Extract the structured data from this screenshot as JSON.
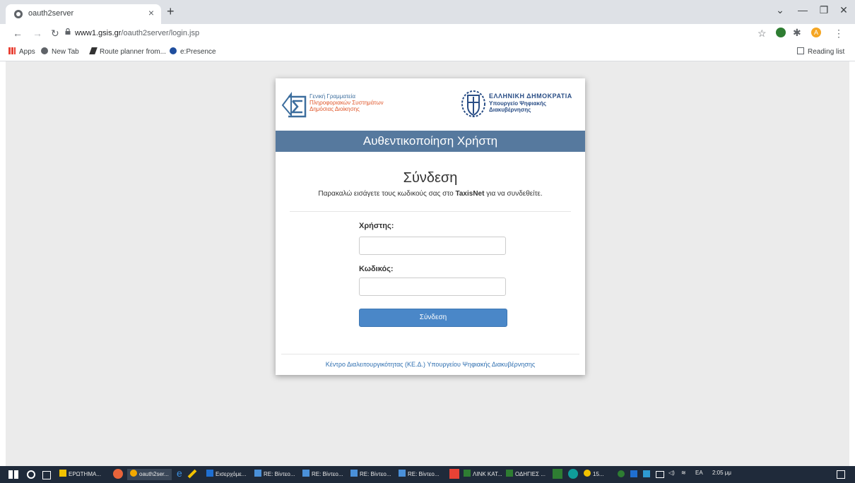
{
  "browser": {
    "tab_title": "oauth2server",
    "tab_close": "×",
    "new_tab": "+",
    "window_controls": [
      "⌄",
      "—",
      "❐",
      "✕"
    ],
    "url_host": "www1.gsis.gr",
    "url_path": "/oauth2server/login.jsp",
    "profile_initial": "A",
    "colors": {
      "tabbar": "#dee1e6",
      "profile": "#f5a623"
    }
  },
  "bookmarks": {
    "apps": "Apps",
    "items": [
      "New Tab",
      "Route planner from...",
      "e:Presence"
    ],
    "reading_list": "Reading list"
  },
  "header": {
    "gsis_lines": [
      "Γενική Γραμματεία",
      "Πληροφοριακών Συστημάτων",
      "Δημόσιας Διοίκησης"
    ],
    "gov_title": "ΕΛΛΗΝΙΚΗ ΔΗΜΟΚΡΑΤΙΑ",
    "gov_sub_lines": [
      "Υπουργείο Ψηφιακής",
      "Διακυβέρνησης"
    ]
  },
  "login": {
    "banner": "Αυθεντικοποίηση Χρήστη",
    "title": "Σύνδεση",
    "intro_before": "Παρακαλώ εισάγετε τους κωδικούς σας στο ",
    "intro_bold": "TaxisNet",
    "intro_after": " για να συνδεθείτε.",
    "username_label": "Χρήστης:",
    "username_value": "",
    "password_label": "Κωδικός:",
    "password_value": "",
    "submit_label": "Σύνδεση",
    "footer_link": "Κέντρο Διαλειτουργικότητας (ΚΕ.Δ.) Υπουργείου Ψηφιακής Διακυβέρνησης",
    "colors": {
      "banner": "#56799e",
      "button": "#4a87c8",
      "link": "#2f6fb0"
    }
  },
  "taskbar": {
    "items": [
      {
        "label": "ΕΡΩΤΗΜΑ...",
        "color": "#f2c200"
      },
      {
        "label": "oauth2ser...",
        "color": "#f2a900"
      },
      {
        "label": "Εισερχόμε...",
        "color": "#1f6fd1"
      },
      {
        "label": "RE: Βίντεο...",
        "color": "#4a90d9"
      },
      {
        "label": "RE: Βίντεο...",
        "color": "#4a90d9"
      },
      {
        "label": "RE: Βίντεο...",
        "color": "#4a90d9"
      },
      {
        "label": "RE: Βίντεο...",
        "color": "#4a90d9"
      },
      {
        "label": "ΛΙΝΚ ΚΑΤ...",
        "color": "#2e7d32"
      },
      {
        "label": "ΟΔΗΓΙΕΣ ...",
        "color": "#2e7d32"
      },
      {
        "label": "15...",
        "color": "#f2c200"
      }
    ],
    "language": "EA",
    "time": "2:05 μμ"
  }
}
